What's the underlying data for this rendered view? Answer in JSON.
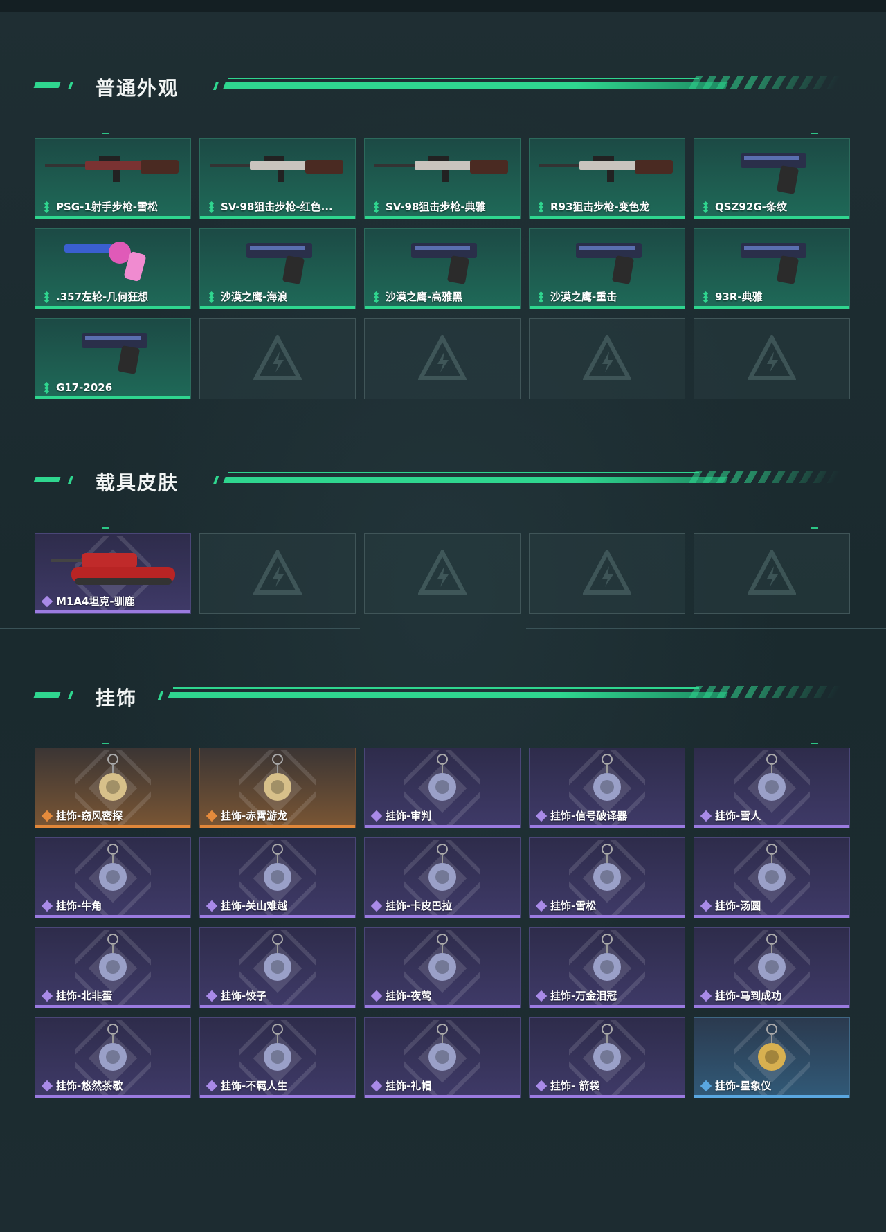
{
  "colors": {
    "accent_green": "#2fd68f",
    "rarity_purple": "#9b7be0",
    "rarity_orange": "#e0873a",
    "rarity_blue": "#5aa7e0"
  },
  "sections": [
    {
      "title": "普通外观",
      "items": [
        {
          "label": "PSG-1射手步枪-雪松",
          "rarity": "green",
          "icon": "rifle-icon"
        },
        {
          "label": "SV-98狙击步枪-红色...",
          "rarity": "green",
          "icon": "sniper-rifle-icon"
        },
        {
          "label": "SV-98狙击步枪-典雅",
          "rarity": "green",
          "icon": "sniper-rifle-icon"
        },
        {
          "label": "R93狙击步枪-变色龙",
          "rarity": "green",
          "icon": "sniper-rifle-icon"
        },
        {
          "label": "QSZ92G-条纹",
          "rarity": "green",
          "icon": "pistol-icon"
        },
        {
          "label": ".357左轮-几何狂想",
          "rarity": "green",
          "icon": "revolver-icon"
        },
        {
          "label": "沙漠之鹰-海浪",
          "rarity": "green",
          "icon": "pistol-icon"
        },
        {
          "label": "沙漠之鹰-高雅黑",
          "rarity": "green",
          "icon": "pistol-icon"
        },
        {
          "label": "沙漠之鹰-重击",
          "rarity": "green",
          "icon": "pistol-icon"
        },
        {
          "label": "93R-典雅",
          "rarity": "green",
          "icon": "pistol-icon"
        },
        {
          "label": "G17-2026",
          "rarity": "green",
          "icon": "pistol-icon"
        }
      ],
      "empty": 4
    },
    {
      "title": "载具皮肤",
      "items": [
        {
          "label": "M1A4坦克-驯鹿",
          "rarity": "purple",
          "icon": "tank-icon"
        }
      ],
      "empty": 4
    },
    {
      "title": "挂饰",
      "items": [
        {
          "label": "挂饰-窃风密探",
          "rarity": "orange",
          "icon": "rabbit-charm-icon"
        },
        {
          "label": "挂饰-赤霄游龙",
          "rarity": "orange",
          "icon": "dragon-charm-icon"
        },
        {
          "label": "挂饰-审判",
          "rarity": "purple",
          "icon": "card-charm-icon"
        },
        {
          "label": "挂饰-信号破译器",
          "rarity": "purple",
          "icon": "device-charm-icon"
        },
        {
          "label": "挂饰-雪人",
          "rarity": "purple",
          "icon": "snowman-charm-icon"
        },
        {
          "label": "挂饰-牛角",
          "rarity": "purple",
          "icon": "horns-charm-icon"
        },
        {
          "label": "挂饰-关山难越",
          "rarity": "purple",
          "icon": "scroll-charm-icon"
        },
        {
          "label": "挂饰-卡皮巴拉",
          "rarity": "purple",
          "icon": "capybara-charm-icon"
        },
        {
          "label": "挂饰-雪松",
          "rarity": "purple",
          "icon": "tree-charm-icon"
        },
        {
          "label": "挂饰-汤圆",
          "rarity": "purple",
          "icon": "bowl-charm-icon"
        },
        {
          "label": "挂饰-北非蛋",
          "rarity": "purple",
          "icon": "pan-charm-icon"
        },
        {
          "label": "挂饰-饺子",
          "rarity": "purple",
          "icon": "plate-charm-icon"
        },
        {
          "label": "挂饰-夜莺",
          "rarity": "purple",
          "icon": "bird-charm-icon"
        },
        {
          "label": "挂饰-万金泪冠",
          "rarity": "purple",
          "icon": "crown-charm-icon"
        },
        {
          "label": "挂饰-马到成功",
          "rarity": "purple",
          "icon": "horse-charm-icon"
        },
        {
          "label": "挂饰-悠然茶歇",
          "rarity": "purple",
          "icon": "cupcake-charm-icon"
        },
        {
          "label": "挂饰-不羁人生",
          "rarity": "purple",
          "icon": "sneaker-charm-icon"
        },
        {
          "label": "挂饰-礼帽",
          "rarity": "purple",
          "icon": "hat-charm-icon"
        },
        {
          "label": "挂饰- 箭袋",
          "rarity": "purple",
          "icon": "quiver-charm-icon"
        },
        {
          "label": "挂饰-星象仪",
          "rarity": "blue",
          "icon": "astrolabe-charm-icon"
        }
      ],
      "empty": 0
    }
  ]
}
